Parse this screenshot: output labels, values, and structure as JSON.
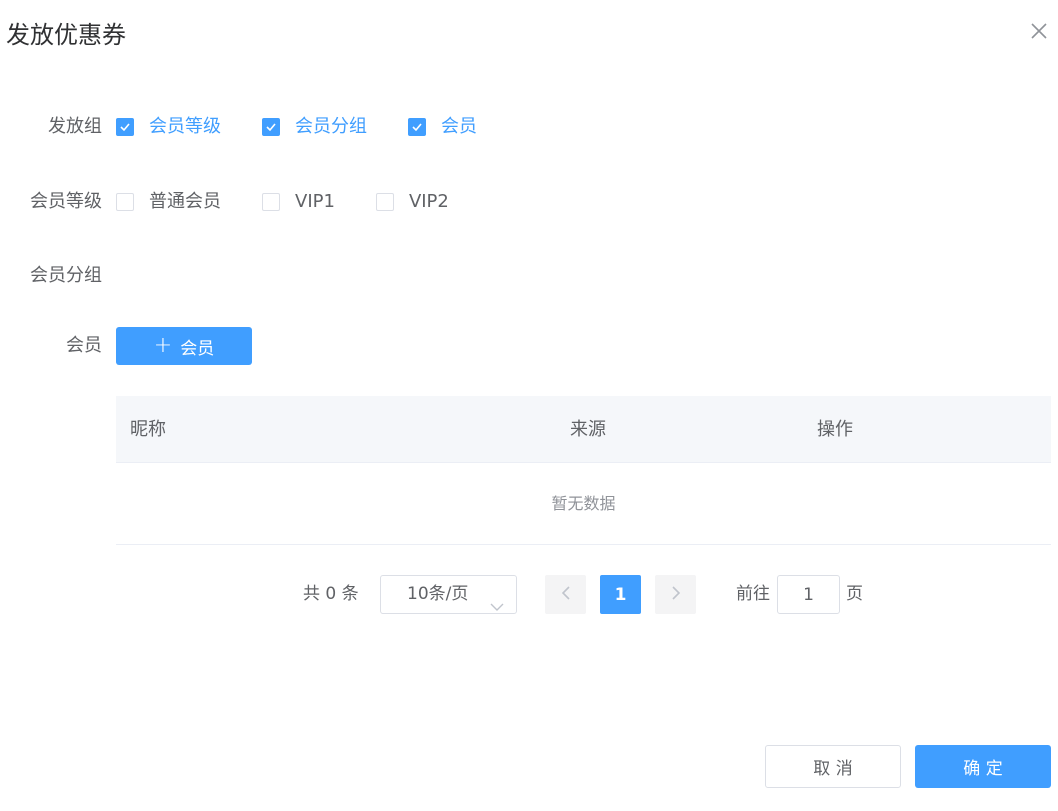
{
  "dialog": {
    "title": "发放优惠券",
    "close_icon": "close-icon"
  },
  "form": {
    "group_label": "发放组",
    "group_options": [
      {
        "label": "会员等级",
        "checked": true
      },
      {
        "label": "会员分组",
        "checked": true
      },
      {
        "label": "会员",
        "checked": true
      }
    ],
    "level_label": "会员等级",
    "level_options": [
      {
        "label": "普通会员",
        "checked": false
      },
      {
        "label": "VIP1",
        "checked": false
      },
      {
        "label": "VIP2",
        "checked": false
      }
    ],
    "member_group_label": "会员分组",
    "member_label": "会员",
    "add_member_button": "会员"
  },
  "table": {
    "columns": [
      "昵称",
      "来源",
      "操作"
    ],
    "empty_text": "暂无数据"
  },
  "pagination": {
    "total_text": "共 0 条",
    "page_size": "10条/页",
    "current_page": "1",
    "goto_prefix": "前往",
    "goto_value": "1",
    "goto_suffix": "页"
  },
  "footer": {
    "cancel_label": "取 消",
    "ok_label": "确 定"
  },
  "colors": {
    "primary": "#409eff",
    "text": "#606266",
    "title": "#303133",
    "header_bg": "#f5f7fa"
  }
}
